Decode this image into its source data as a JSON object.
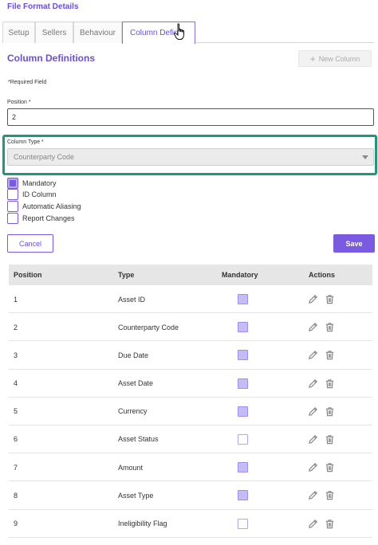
{
  "page": {
    "header": "File Format Details"
  },
  "tabs": [
    {
      "label": "Setup",
      "active": false
    },
    {
      "label": "Sellers",
      "active": false
    },
    {
      "label": "Behaviour",
      "active": false
    },
    {
      "label": "Column Definiti",
      "active": true
    }
  ],
  "section": {
    "title": "Column Definitions",
    "new_column_label": "New Column",
    "required_note": "*Required Field"
  },
  "form": {
    "position_label": "Position *",
    "position_value": "2",
    "column_type_label": "Column Type *",
    "column_type_value": "Counterparty Code",
    "checkboxes": [
      {
        "label": "Mandatory",
        "checked": true
      },
      {
        "label": "ID Column",
        "checked": false
      },
      {
        "label": "Automatic Aliasing",
        "checked": false
      },
      {
        "label": "Report Changes",
        "checked": false
      }
    ],
    "cancel_label": "Cancel",
    "save_label": "Save"
  },
  "table": {
    "headers": {
      "position": "Position",
      "type": "Type",
      "mandatory": "Mandatory",
      "actions": "Actions"
    },
    "rows": [
      {
        "position": "1",
        "type": "Asset ID",
        "mandatory": true
      },
      {
        "position": "2",
        "type": "Counterparty Code",
        "mandatory": true
      },
      {
        "position": "3",
        "type": "Due Date",
        "mandatory": true
      },
      {
        "position": "4",
        "type": "Asset Date",
        "mandatory": true
      },
      {
        "position": "5",
        "type": "Currency",
        "mandatory": true
      },
      {
        "position": "6",
        "type": "Asset Status",
        "mandatory": false
      },
      {
        "position": "7",
        "type": "Amount",
        "mandatory": true
      },
      {
        "position": "8",
        "type": "Asset Type",
        "mandatory": true
      },
      {
        "position": "9",
        "type": "Ineligibility Flag",
        "mandatory": false
      }
    ]
  },
  "colors": {
    "accent": "#7a5ae0",
    "highlight": "#1a9a7a"
  },
  "icons": {
    "edit": "pencil-icon",
    "delete": "trash-icon",
    "add": "plus-icon",
    "cursor": "hand-pointer-icon"
  }
}
